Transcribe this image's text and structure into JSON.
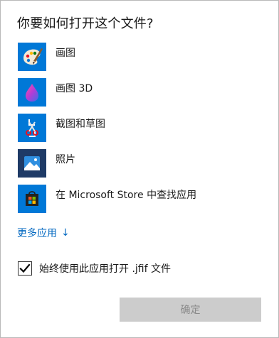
{
  "dialog": {
    "title": "你要如何打开这个文件?",
    "apps": [
      {
        "label": "画图",
        "icon": "paint-icon"
      },
      {
        "label": "画图 3D",
        "icon": "paint-3d-icon"
      },
      {
        "label": "截图和草图",
        "icon": "snip-sketch-icon"
      },
      {
        "label": "照片",
        "icon": "photos-icon"
      },
      {
        "label": "在 Microsoft Store 中查找应用",
        "icon": "store-icon"
      }
    ],
    "more_apps_label": "更多应用",
    "more_apps_arrow": "↓",
    "always_use_label": "始终使用此应用打开 .jfif 文件",
    "always_use_checked": true,
    "ok_label": "确定",
    "ok_enabled": false
  },
  "colors": {
    "tile_blue": "#0078d7",
    "link_blue": "#0067c0",
    "button_disabled_bg": "#cccccc",
    "button_disabled_text": "#8a8a8a"
  }
}
